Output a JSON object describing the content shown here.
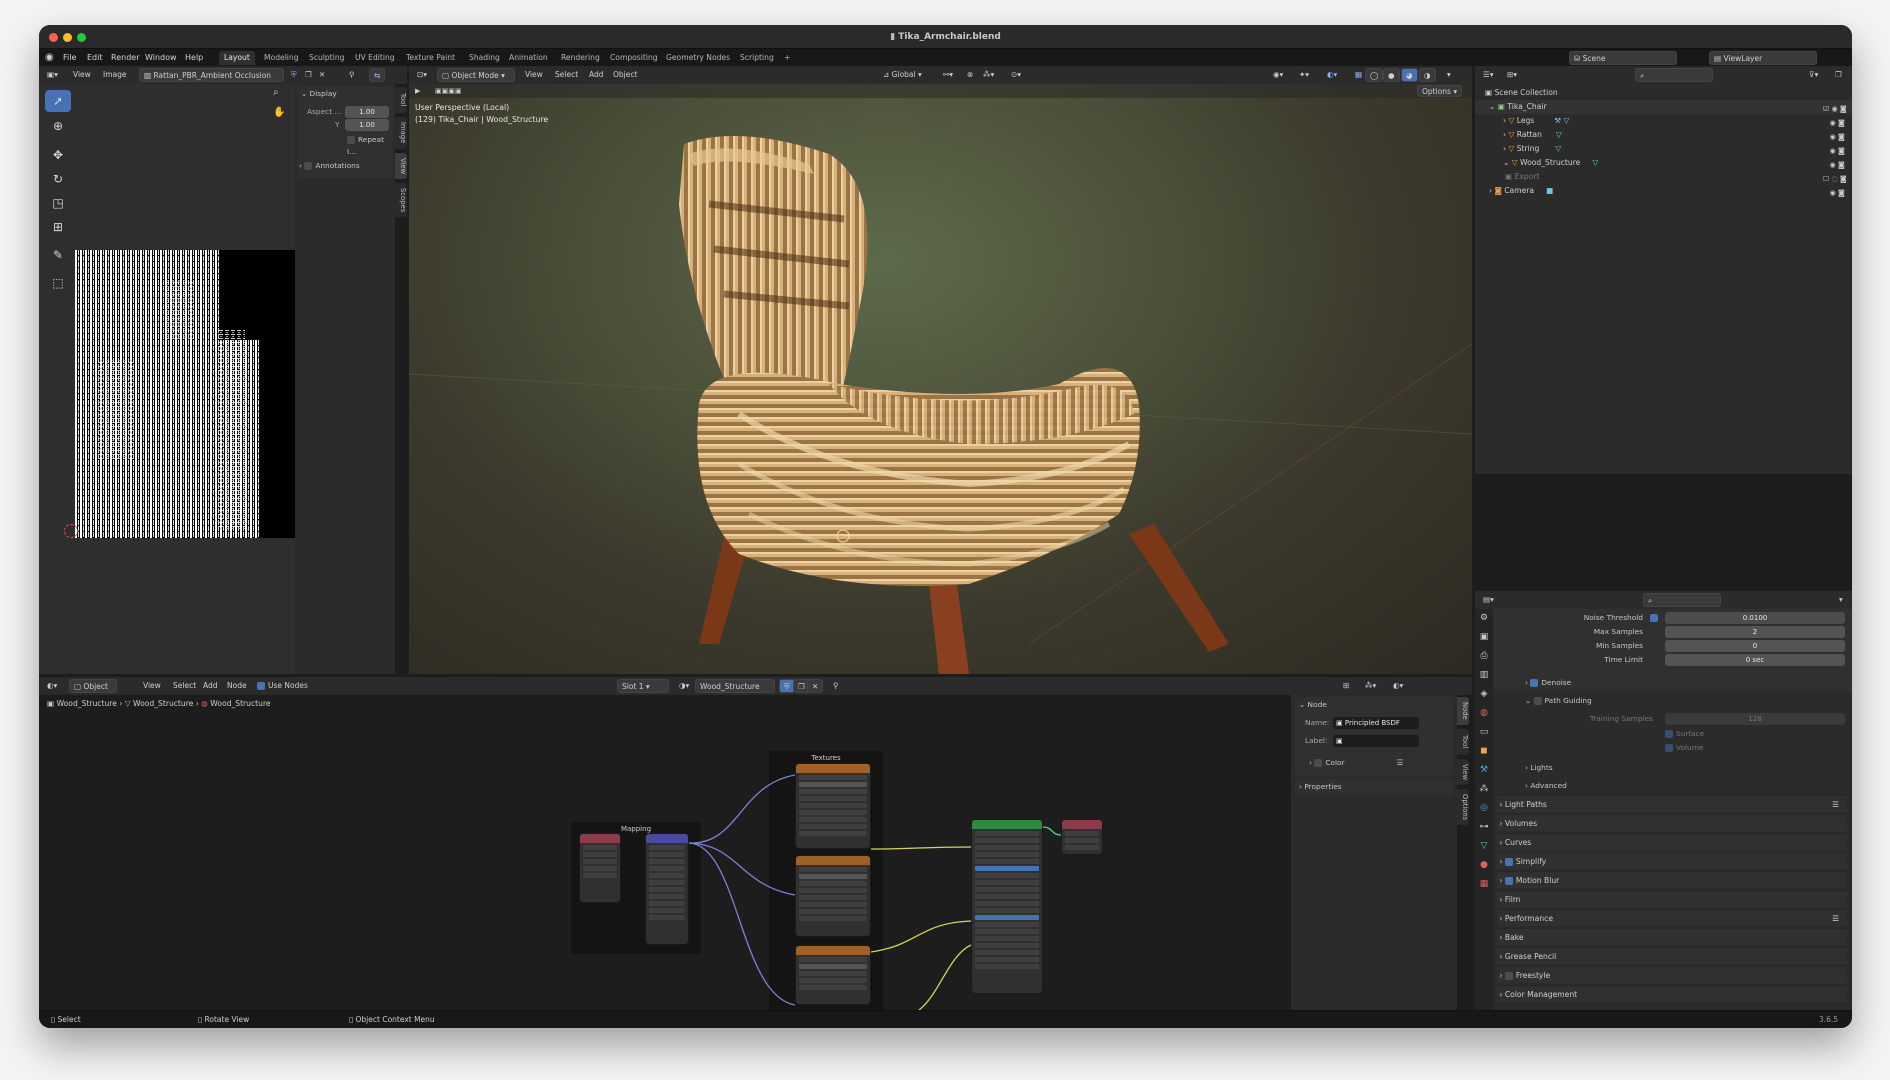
{
  "window": {
    "title": "Tika_Armchair.blend"
  },
  "menu": [
    "File",
    "Edit",
    "Render",
    "Window",
    "Help"
  ],
  "workspaces": [
    "Layout",
    "Modeling",
    "Sculpting",
    "UV Editing",
    "Texture Paint",
    "Shading",
    "Animation",
    "Rendering",
    "Compositing",
    "Geometry Nodes",
    "Scripting",
    "+"
  ],
  "topright": {
    "scene": "Scene",
    "view_layer": "ViewLayer"
  },
  "image_editor": {
    "view": "View",
    "image": "Image",
    "image_name": "Rattan_PBR_Ambient Occlusion",
    "display": "Display",
    "aspect_label": "Aspect ...",
    "aspect_x": "1.00",
    "y_label": "Y",
    "aspect_y": "1.00",
    "repeat": "Repeat I...",
    "annotations": "Annotations",
    "tabs": [
      "Tool",
      "Image",
      "View",
      "Scopes"
    ]
  },
  "viewport": {
    "mode": "Object Mode",
    "menus": [
      "View",
      "Select",
      "Add",
      "Object"
    ],
    "transform": "Global",
    "options": "Options",
    "info_line1": "User Perspective (Local)",
    "info_line2": "(129) Tika_Chair | Wood_Structure"
  },
  "outliner": {
    "root": "Scene Collection",
    "items": [
      {
        "name": "Tika_Chair"
      },
      {
        "name": "Legs"
      },
      {
        "name": "Rattan"
      },
      {
        "name": "String"
      },
      {
        "name": "Wood_Structure"
      },
      {
        "name": "Export"
      },
      {
        "name": "Camera"
      }
    ]
  },
  "properties": {
    "noise_threshold_label": "Noise Threshold",
    "noise_threshold": "0.0100",
    "max_samples_label": "Max Samples",
    "max_samples": "2",
    "min_samples_label": "Min Samples",
    "min_samples": "0",
    "time_limit_label": "Time Limit",
    "time_limit": "0 sec",
    "denoise": "Denoise",
    "path_guiding": "Path Guiding",
    "training_samples_label": "Training Samples",
    "training_samples": "128",
    "surface": "Surface",
    "volume": "Volume",
    "lights": "Lights",
    "advanced": "Advanced",
    "sections": [
      "Light Paths",
      "Volumes",
      "Curves",
      "Simplify",
      "Motion Blur",
      "Film",
      "Performance",
      "Bake",
      "Grease Pencil",
      "Freestyle",
      "Color Management"
    ]
  },
  "node_editor": {
    "type": "Object",
    "menus": [
      "View",
      "Select",
      "Add",
      "Node"
    ],
    "use_nodes": "Use Nodes",
    "slot": "Slot 1",
    "material": "Wood_Structure",
    "breadcrumb": [
      "Wood_Structure",
      "Wood_Structure",
      "Wood_Structure"
    ],
    "frame_mapping": "Mapping",
    "frame_textures": "Textures",
    "sidebar_node": "Node",
    "name_label": "Name:",
    "name_value": "Principled BSDF",
    "label_label": "Label:",
    "color": "Color",
    "properties": "Properties",
    "tabs": [
      "Node",
      "Tool",
      "View",
      "Options"
    ]
  },
  "statusbar": {
    "select": "Select",
    "rotate": "Rotate View",
    "context": "Object Context Menu",
    "version": "3.6.5"
  },
  "colors": {
    "accent": "#4772b3",
    "header": "#2b2b2b",
    "panel": "#303030",
    "bg": "#1d1d1d"
  }
}
